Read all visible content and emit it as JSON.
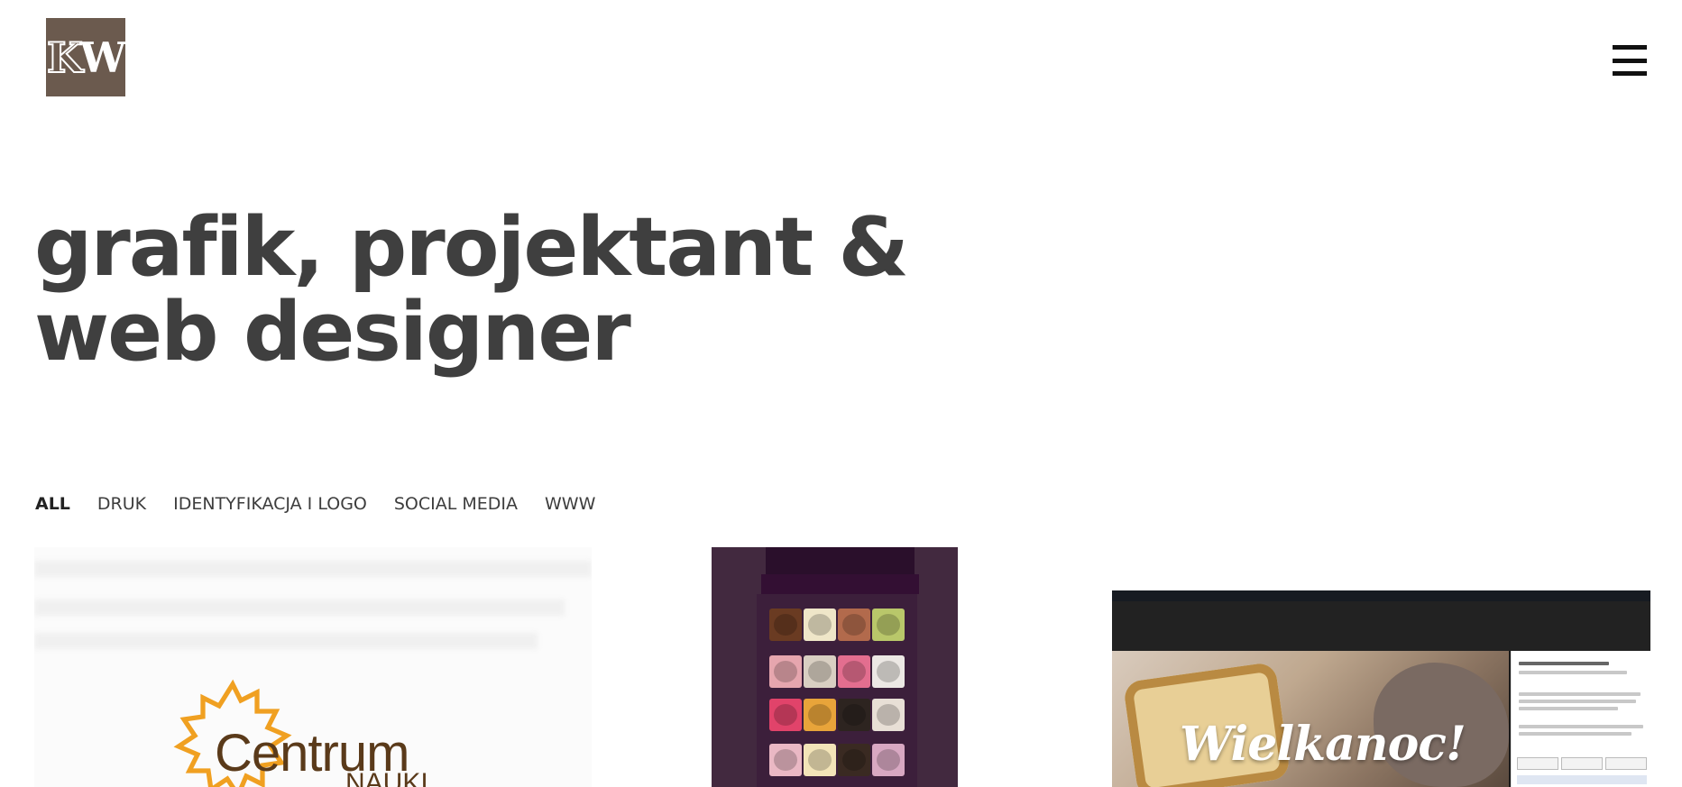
{
  "brand": {
    "logo_text_k": "K",
    "logo_text_w": "W",
    "logo_color": "#6b5a4e"
  },
  "header": {
    "menu_icon": "hamburger-icon"
  },
  "headline": {
    "line1": "grafik, projektant &",
    "line2": "web designer"
  },
  "filters": [
    {
      "label": "ALL",
      "active": true
    },
    {
      "label": "DRUK",
      "active": false
    },
    {
      "label": "IDENTYFIKACJA I LOGO",
      "active": false
    },
    {
      "label": "SOCIAL MEDIA",
      "active": false
    },
    {
      "label": "WWW",
      "active": false
    }
  ],
  "gallery": {
    "item1": {
      "logo_word": "Centrum",
      "logo_subword": "NAUKI"
    },
    "item3": {
      "headline": "Wielkanoc!"
    }
  },
  "colors": {
    "text": "#3f3f3f",
    "background": "#ffffff",
    "cake_bg": "#42293f"
  }
}
